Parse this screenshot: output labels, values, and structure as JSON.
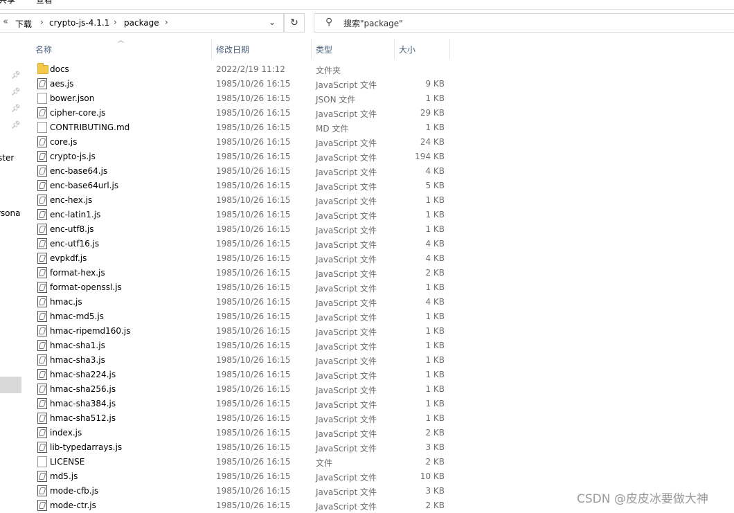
{
  "top_strip": {
    "left": "共享",
    "right": "查看"
  },
  "address_bar": {
    "crumbs": [
      "下载",
      "crypto-js-4.1.1",
      "package"
    ]
  },
  "search": {
    "placeholder": "搜索\"package\""
  },
  "nav": {
    "partial_items": [
      "ster",
      "rsona"
    ]
  },
  "columns": {
    "name": "名称",
    "modified": "修改日期",
    "type": "类型",
    "size": "大小"
  },
  "files": [
    {
      "name": "docs",
      "date": "2022/2/19 11:12",
      "type": "文件夹",
      "size": "",
      "icon": "folder"
    },
    {
      "name": "aes.js",
      "date": "1985/10/26 16:15",
      "type": "JavaScript 文件",
      "size": "9 KB",
      "icon": "js"
    },
    {
      "name": "bower.json",
      "date": "1985/10/26 16:15",
      "type": "JSON 文件",
      "size": "1 KB",
      "icon": "doc"
    },
    {
      "name": "cipher-core.js",
      "date": "1985/10/26 16:15",
      "type": "JavaScript 文件",
      "size": "29 KB",
      "icon": "js"
    },
    {
      "name": "CONTRIBUTING.md",
      "date": "1985/10/26 16:15",
      "type": "MD 文件",
      "size": "1 KB",
      "icon": "doc"
    },
    {
      "name": "core.js",
      "date": "1985/10/26 16:15",
      "type": "JavaScript 文件",
      "size": "24 KB",
      "icon": "js"
    },
    {
      "name": "crypto-js.js",
      "date": "1985/10/26 16:15",
      "type": "JavaScript 文件",
      "size": "194 KB",
      "icon": "js"
    },
    {
      "name": "enc-base64.js",
      "date": "1985/10/26 16:15",
      "type": "JavaScript 文件",
      "size": "4 KB",
      "icon": "js"
    },
    {
      "name": "enc-base64url.js",
      "date": "1985/10/26 16:15",
      "type": "JavaScript 文件",
      "size": "5 KB",
      "icon": "js"
    },
    {
      "name": "enc-hex.js",
      "date": "1985/10/26 16:15",
      "type": "JavaScript 文件",
      "size": "1 KB",
      "icon": "js"
    },
    {
      "name": "enc-latin1.js",
      "date": "1985/10/26 16:15",
      "type": "JavaScript 文件",
      "size": "1 KB",
      "icon": "js"
    },
    {
      "name": "enc-utf8.js",
      "date": "1985/10/26 16:15",
      "type": "JavaScript 文件",
      "size": "1 KB",
      "icon": "js"
    },
    {
      "name": "enc-utf16.js",
      "date": "1985/10/26 16:15",
      "type": "JavaScript 文件",
      "size": "4 KB",
      "icon": "js"
    },
    {
      "name": "evpkdf.js",
      "date": "1985/10/26 16:15",
      "type": "JavaScript 文件",
      "size": "4 KB",
      "icon": "js"
    },
    {
      "name": "format-hex.js",
      "date": "1985/10/26 16:15",
      "type": "JavaScript 文件",
      "size": "2 KB",
      "icon": "js"
    },
    {
      "name": "format-openssl.js",
      "date": "1985/10/26 16:15",
      "type": "JavaScript 文件",
      "size": "1 KB",
      "icon": "js"
    },
    {
      "name": "hmac.js",
      "date": "1985/10/26 16:15",
      "type": "JavaScript 文件",
      "size": "4 KB",
      "icon": "js"
    },
    {
      "name": "hmac-md5.js",
      "date": "1985/10/26 16:15",
      "type": "JavaScript 文件",
      "size": "1 KB",
      "icon": "js"
    },
    {
      "name": "hmac-ripemd160.js",
      "date": "1985/10/26 16:15",
      "type": "JavaScript 文件",
      "size": "1 KB",
      "icon": "js"
    },
    {
      "name": "hmac-sha1.js",
      "date": "1985/10/26 16:15",
      "type": "JavaScript 文件",
      "size": "1 KB",
      "icon": "js"
    },
    {
      "name": "hmac-sha3.js",
      "date": "1985/10/26 16:15",
      "type": "JavaScript 文件",
      "size": "1 KB",
      "icon": "js"
    },
    {
      "name": "hmac-sha224.js",
      "date": "1985/10/26 16:15",
      "type": "JavaScript 文件",
      "size": "1 KB",
      "icon": "js"
    },
    {
      "name": "hmac-sha256.js",
      "date": "1985/10/26 16:15",
      "type": "JavaScript 文件",
      "size": "1 KB",
      "icon": "js"
    },
    {
      "name": "hmac-sha384.js",
      "date": "1985/10/26 16:15",
      "type": "JavaScript 文件",
      "size": "1 KB",
      "icon": "js"
    },
    {
      "name": "hmac-sha512.js",
      "date": "1985/10/26 16:15",
      "type": "JavaScript 文件",
      "size": "1 KB",
      "icon": "js"
    },
    {
      "name": "index.js",
      "date": "1985/10/26 16:15",
      "type": "JavaScript 文件",
      "size": "2 KB",
      "icon": "js"
    },
    {
      "name": "lib-typedarrays.js",
      "date": "1985/10/26 16:15",
      "type": "JavaScript 文件",
      "size": "3 KB",
      "icon": "js"
    },
    {
      "name": "LICENSE",
      "date": "1985/10/26 16:15",
      "type": "文件",
      "size": "2 KB",
      "icon": "doc"
    },
    {
      "name": "md5.js",
      "date": "1985/10/26 16:15",
      "type": "JavaScript 文件",
      "size": "10 KB",
      "icon": "js"
    },
    {
      "name": "mode-cfb.js",
      "date": "1985/10/26 16:15",
      "type": "JavaScript 文件",
      "size": "3 KB",
      "icon": "js"
    },
    {
      "name": "mode-ctr.js",
      "date": "1985/10/26 16:15",
      "type": "JavaScript 文件",
      "size": "2 KB",
      "icon": "js"
    }
  ],
  "watermark": "CSDN @皮皮冰要做大神"
}
